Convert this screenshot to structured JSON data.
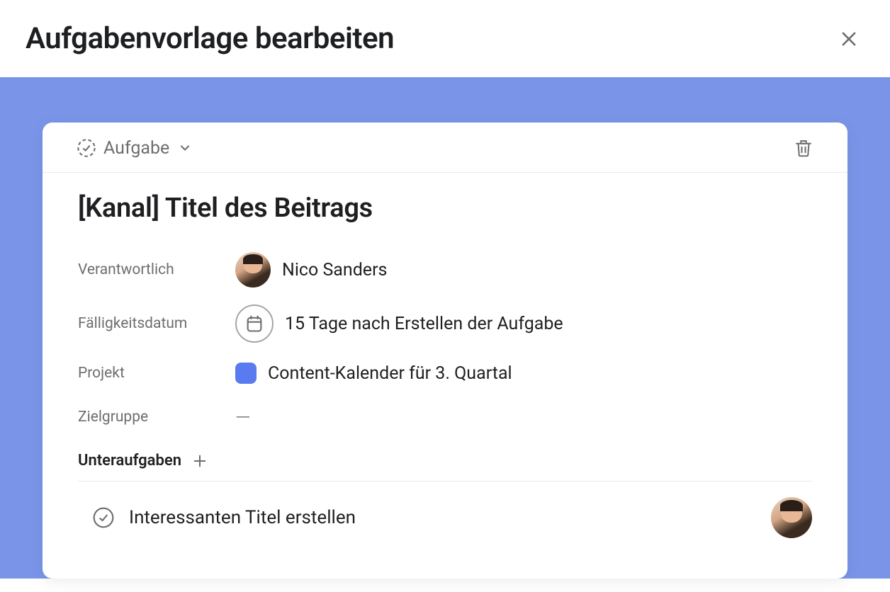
{
  "modal": {
    "title": "Aufgabenvorlage bearbeiten"
  },
  "task": {
    "typeLabel": "Aufgabe",
    "title": "[Kanal] Titel des Beitrags",
    "fields": {
      "assigneeLabel": "Verantwortlich",
      "assigneeValue": "Nico Sanders",
      "dueDateLabel": "Fälligkeitsdatum",
      "dueDateValue": "15 Tage nach Erstellen der Aufgabe",
      "projectLabel": "Projekt",
      "projectValue": "Content-Kalender für 3. Quartal",
      "audienceLabel": "Zielgruppe",
      "audienceValue": "—"
    },
    "subtasks": {
      "header": "Unteraufgaben",
      "items": [
        {
          "title": "Interessanten Titel erstellen"
        }
      ]
    }
  },
  "colors": {
    "blueBg": "#7a95e8",
    "projectChip": "#5a7bef"
  }
}
